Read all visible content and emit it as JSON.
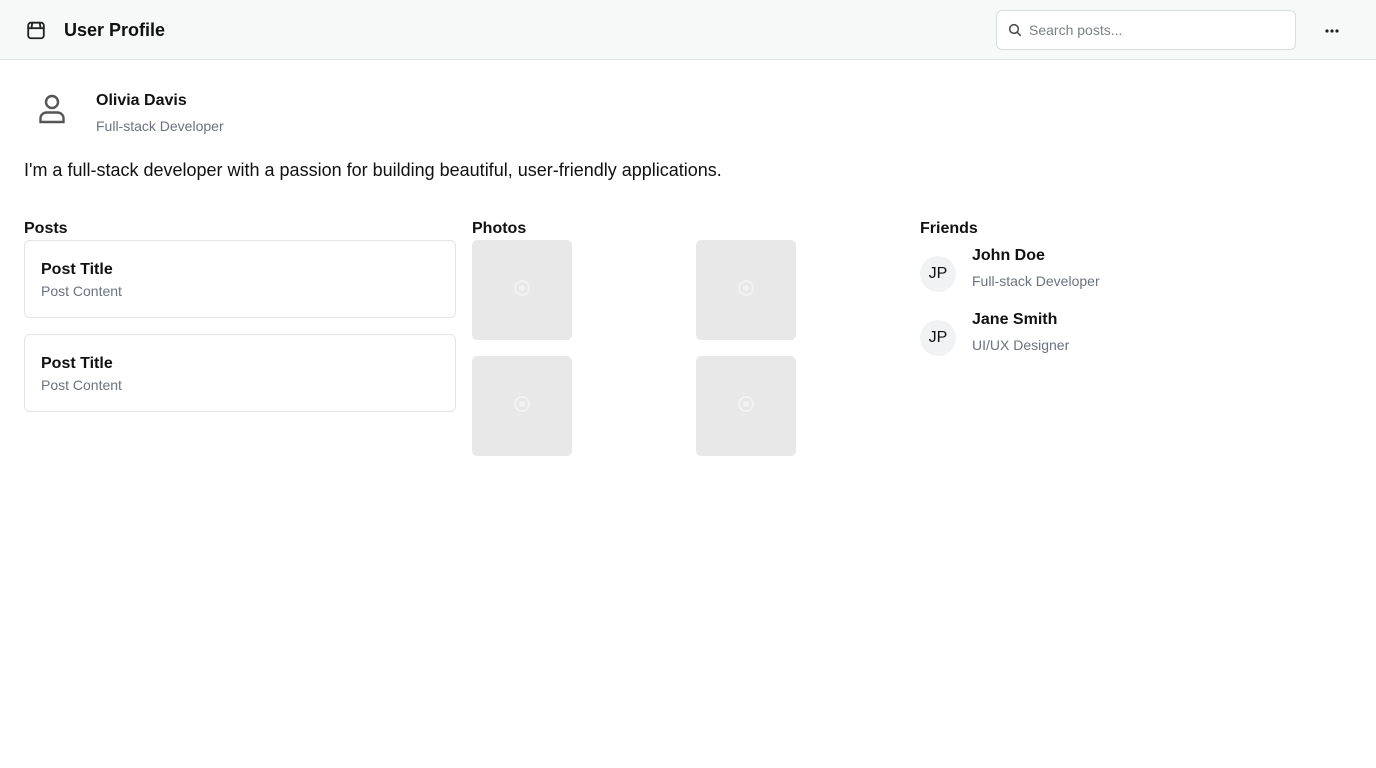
{
  "header": {
    "title": "User Profile",
    "app_icon": "package-icon",
    "search": {
      "placeholder": "Search posts...",
      "value": "",
      "icon": "search-icon"
    },
    "more_icon": "more-horizontal-icon"
  },
  "profile": {
    "avatar_icon": "user-icon",
    "name": "Olivia Davis",
    "role": "Full-stack Developer",
    "bio": "I'm a full-stack developer with a passion for building beautiful, user-friendly applications."
  },
  "posts": {
    "heading": "Posts",
    "items": [
      {
        "title": "Post Title",
        "content": "Post Content"
      },
      {
        "title": "Post Title",
        "content": "Post Content"
      }
    ]
  },
  "photos": {
    "heading": "Photos",
    "count": 4,
    "placeholder_icon": "image-placeholder-icon"
  },
  "friends": {
    "heading": "Friends",
    "items": [
      {
        "initials": "JP",
        "name": "John Doe",
        "role": "Full-stack Developer"
      },
      {
        "initials": "JP",
        "name": "Jane Smith",
        "role": "UI/UX Designer"
      }
    ]
  },
  "colors": {
    "header_bg": "#f7f8f8",
    "text_primary": "#111111",
    "text_muted": "#6b7280",
    "border": "#e1e4e8",
    "photo_bg": "#e8e8e8"
  }
}
